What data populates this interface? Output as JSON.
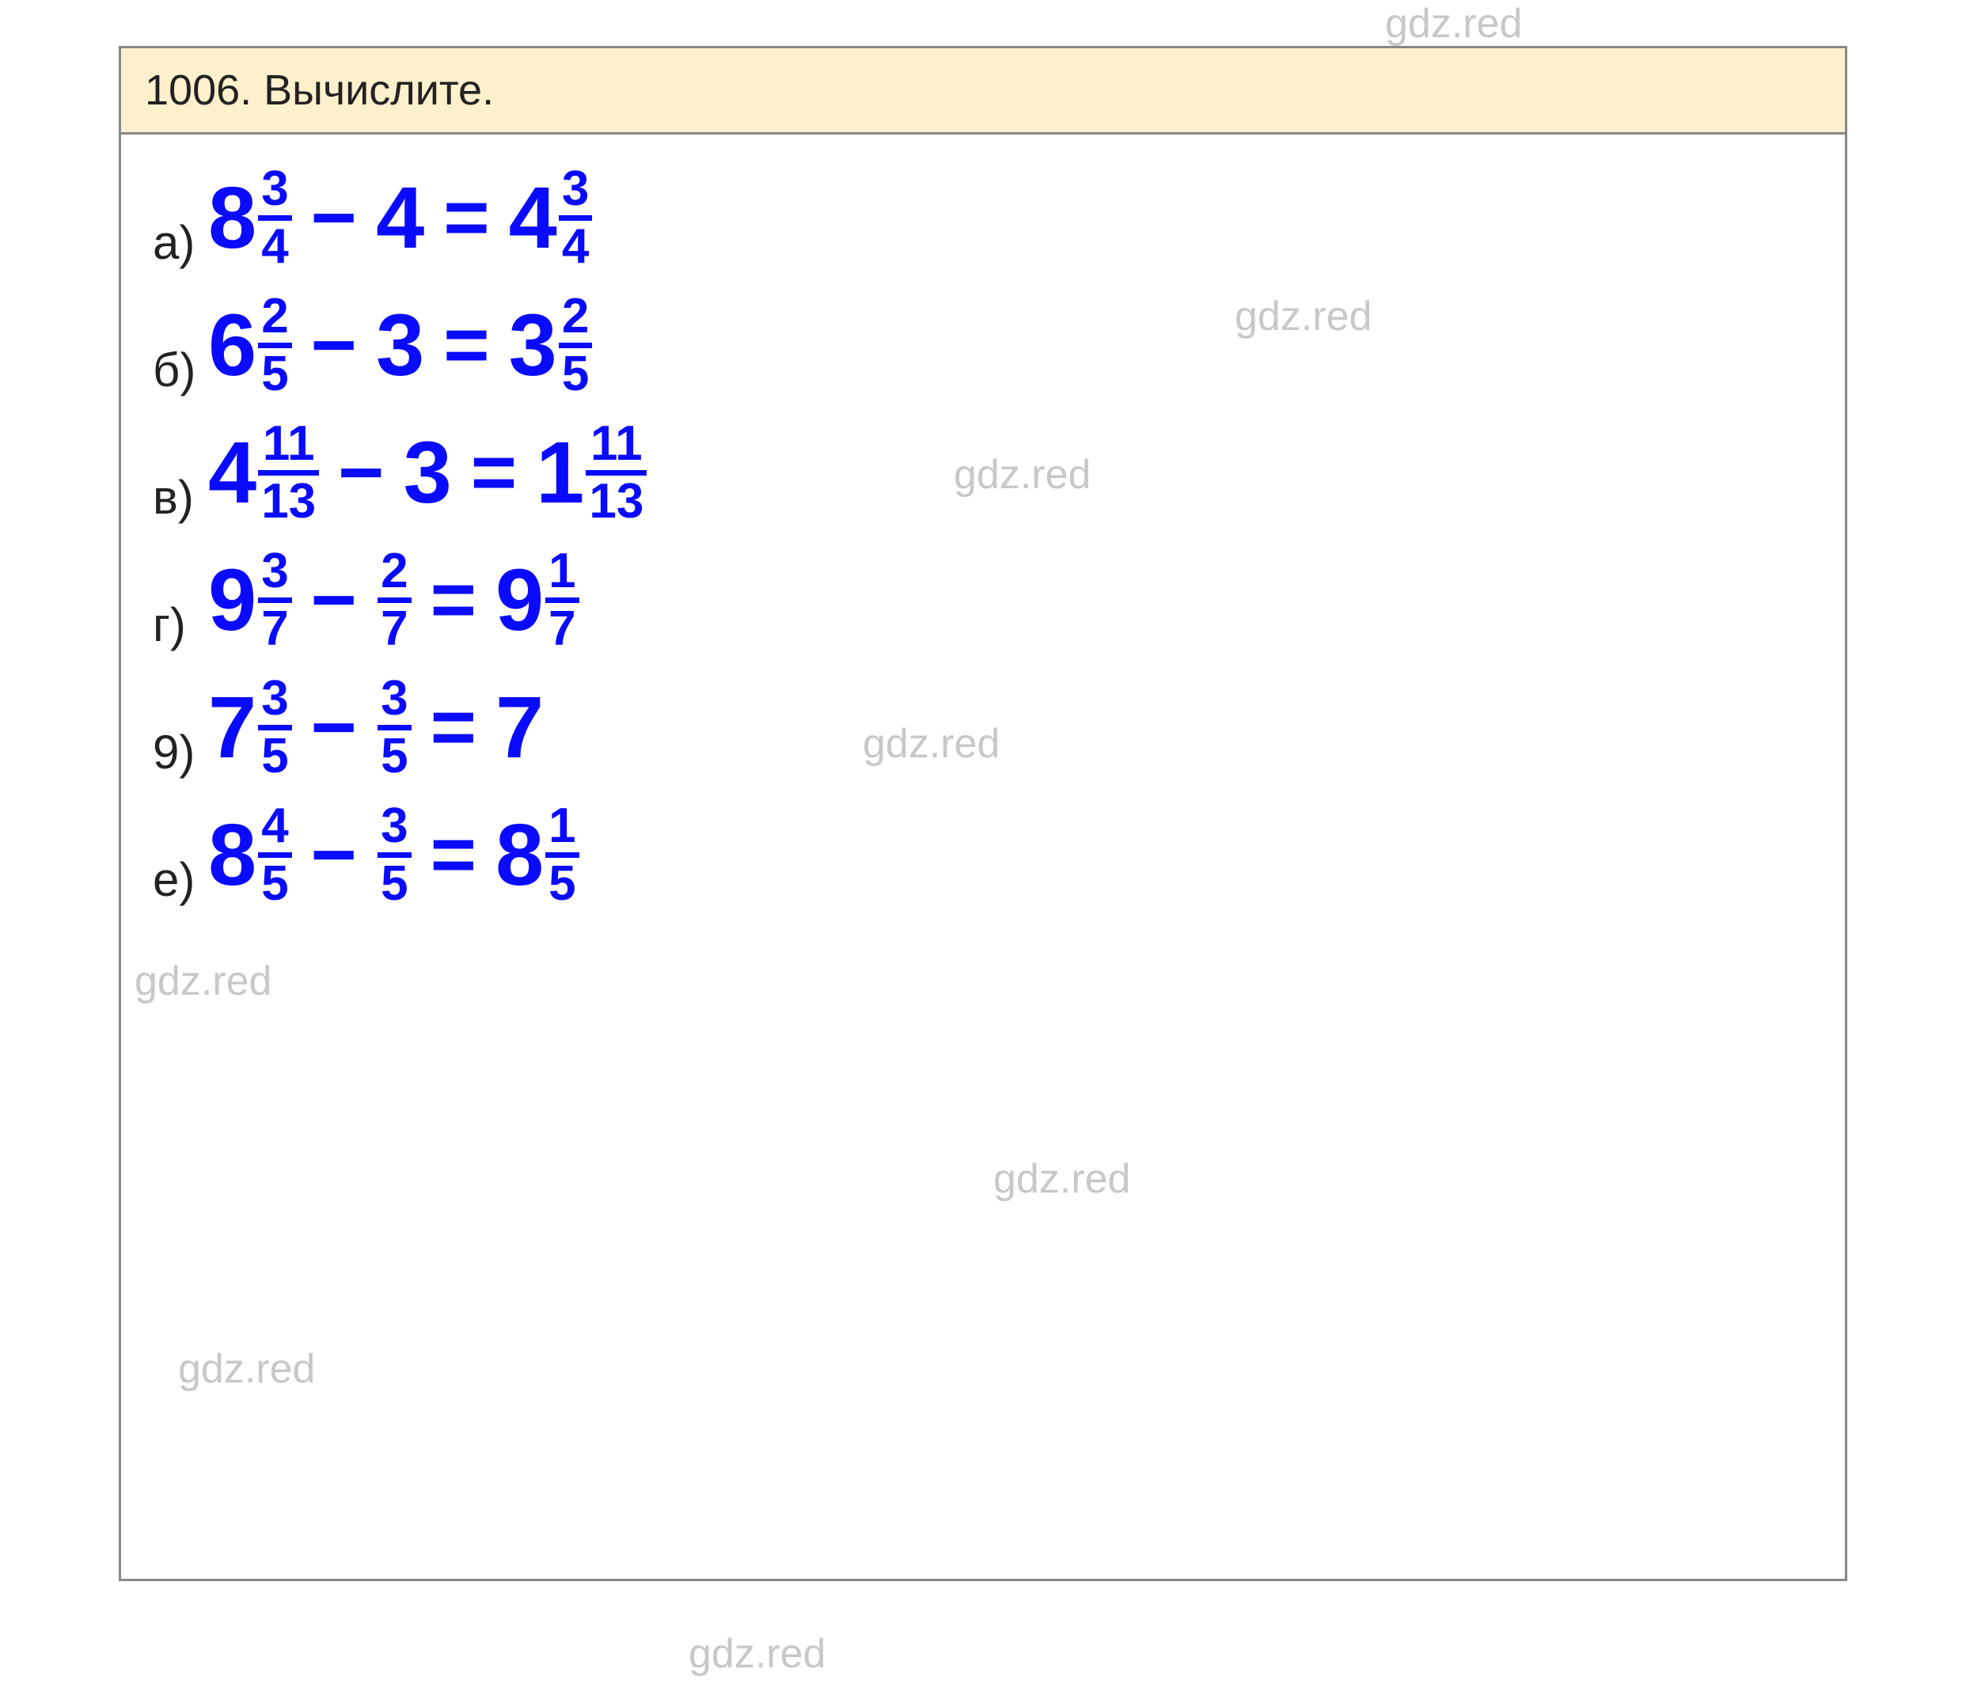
{
  "watermarks": {
    "w1": "gdz.red",
    "w2": "gdz.red",
    "w3": "gdz.red",
    "w4": "gdz.red",
    "w5": "gdz.red",
    "w6": "gdz.red",
    "w7": "gdz.red",
    "w8": "gdz.red"
  },
  "header": {
    "title": "1006. Вычислите."
  },
  "rows": {
    "a": {
      "label": "а)",
      "t1_whole": "8",
      "t1_num": "3",
      "t1_den": "4",
      "op1": "−",
      "t2": "4",
      "eq": "=",
      "r_whole": "4",
      "r_num": "3",
      "r_den": "4"
    },
    "b": {
      "label": "б)",
      "t1_whole": "6",
      "t1_num": "2",
      "t1_den": "5",
      "op1": "−",
      "t2": "3",
      "eq": "=",
      "r_whole": "3",
      "r_num": "2",
      "r_den": "5"
    },
    "v": {
      "label": "в)",
      "t1_whole": "4",
      "t1_num": "11",
      "t1_den": "13",
      "op1": "−",
      "t2": "3",
      "eq": "=",
      "r_whole": "1",
      "r_num": "11",
      "r_den": "13"
    },
    "g": {
      "label": "г)",
      "t1_whole": "9",
      "t1_num": "3",
      "t1_den": "7",
      "op1": "−",
      "t2_num": "2",
      "t2_den": "7",
      "eq": "=",
      "r_whole": "9",
      "r_num": "1",
      "r_den": "7"
    },
    "d": {
      "label": "9)",
      "t1_whole": "7",
      "t1_num": "3",
      "t1_den": "5",
      "op1": "−",
      "t2_num": "3",
      "t2_den": "5",
      "eq": "=",
      "r_whole": "7"
    },
    "e": {
      "label": "е)",
      "t1_whole": "8",
      "t1_num": "4",
      "t1_den": "5",
      "op1": "−",
      "t2_num": "3",
      "t2_den": "5",
      "eq": "=",
      "r_whole": "8",
      "r_num": "1",
      "r_den": "5"
    }
  }
}
